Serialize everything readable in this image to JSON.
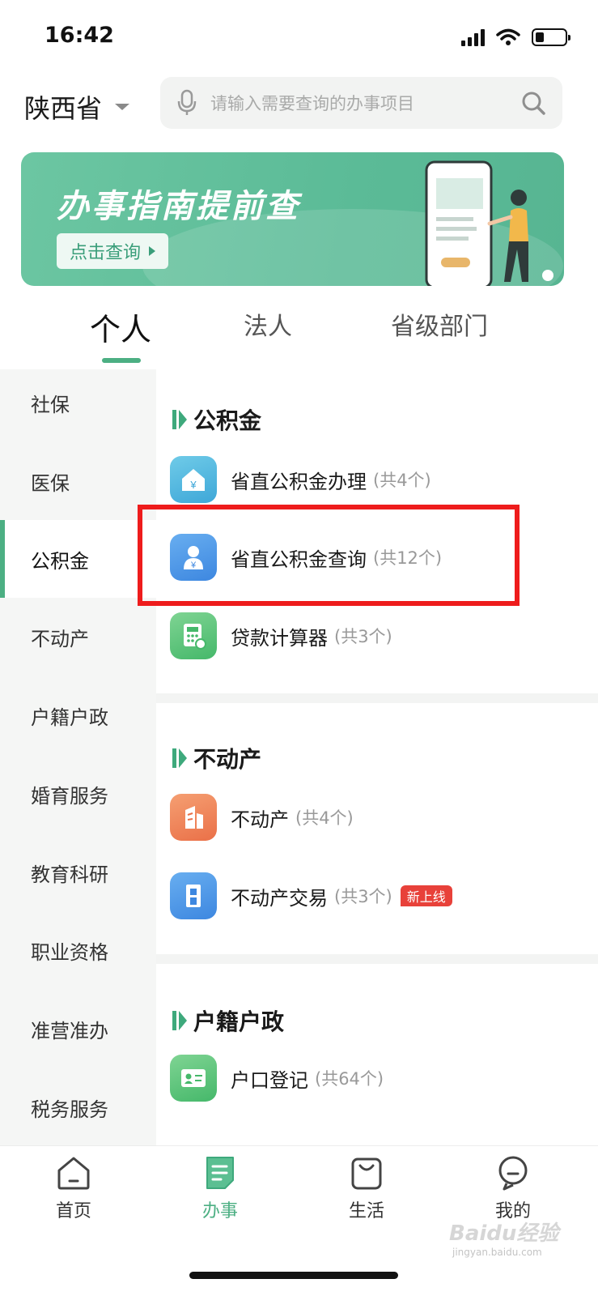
{
  "status": {
    "time": "16:42"
  },
  "header": {
    "province": "陕西省",
    "search_placeholder": "请输入需要查询的办事项目"
  },
  "banner": {
    "title": "办事指南提前查",
    "button": "点击查询"
  },
  "tabs": [
    {
      "label": "个人",
      "active": true
    },
    {
      "label": "法人",
      "active": false
    },
    {
      "label": "省级部门",
      "active": false
    }
  ],
  "sidebar": {
    "items": [
      {
        "label": "社保",
        "active": false
      },
      {
        "label": "医保",
        "active": false
      },
      {
        "label": "公积金",
        "active": true
      },
      {
        "label": "不动产",
        "active": false
      },
      {
        "label": "户籍户政",
        "active": false
      },
      {
        "label": "婚育服务",
        "active": false
      },
      {
        "label": "教育科研",
        "active": false
      },
      {
        "label": "职业资格",
        "active": false
      },
      {
        "label": "准营准办",
        "active": false
      },
      {
        "label": "税务服务",
        "active": false
      }
    ]
  },
  "sections": [
    {
      "title": "公积金",
      "items": [
        {
          "name": "省直公积金办理",
          "count": "(共4个)",
          "icon": "house-yuan-icon",
          "color": "#4fb3dd"
        },
        {
          "name": "省直公积金查询",
          "count": "(共12个)",
          "icon": "person-yuan-icon",
          "color": "#4a94e6",
          "highlighted": true
        },
        {
          "name": "贷款计算器",
          "count": "(共3个)",
          "icon": "calculator-icon",
          "color": "#5bc47a"
        }
      ]
    },
    {
      "title": "不动产",
      "items": [
        {
          "name": "不动产",
          "count": "(共4个)",
          "icon": "building-icon",
          "color": "#f08458"
        },
        {
          "name": "不动产交易",
          "count": "(共3个)",
          "icon": "door-icon",
          "color": "#4a94e6",
          "badge": "新上线"
        }
      ]
    },
    {
      "title": "户籍户政",
      "items": [
        {
          "name": "户口登记",
          "count": "(共64个)",
          "icon": "id-card-icon",
          "color": "#5bc47a"
        }
      ]
    }
  ],
  "bottom_nav": [
    {
      "label": "首页",
      "icon": "home-icon",
      "active": false
    },
    {
      "label": "办事",
      "icon": "document-icon",
      "active": true
    },
    {
      "label": "生活",
      "icon": "bag-icon",
      "active": false
    },
    {
      "label": "我的",
      "icon": "profile-icon",
      "active": false
    }
  ],
  "watermark": {
    "brand": "Baidu经验",
    "url": "jingyan.baidu.com"
  },
  "colors": {
    "accent": "#4caf83",
    "highlight": "#ee1c1c"
  }
}
